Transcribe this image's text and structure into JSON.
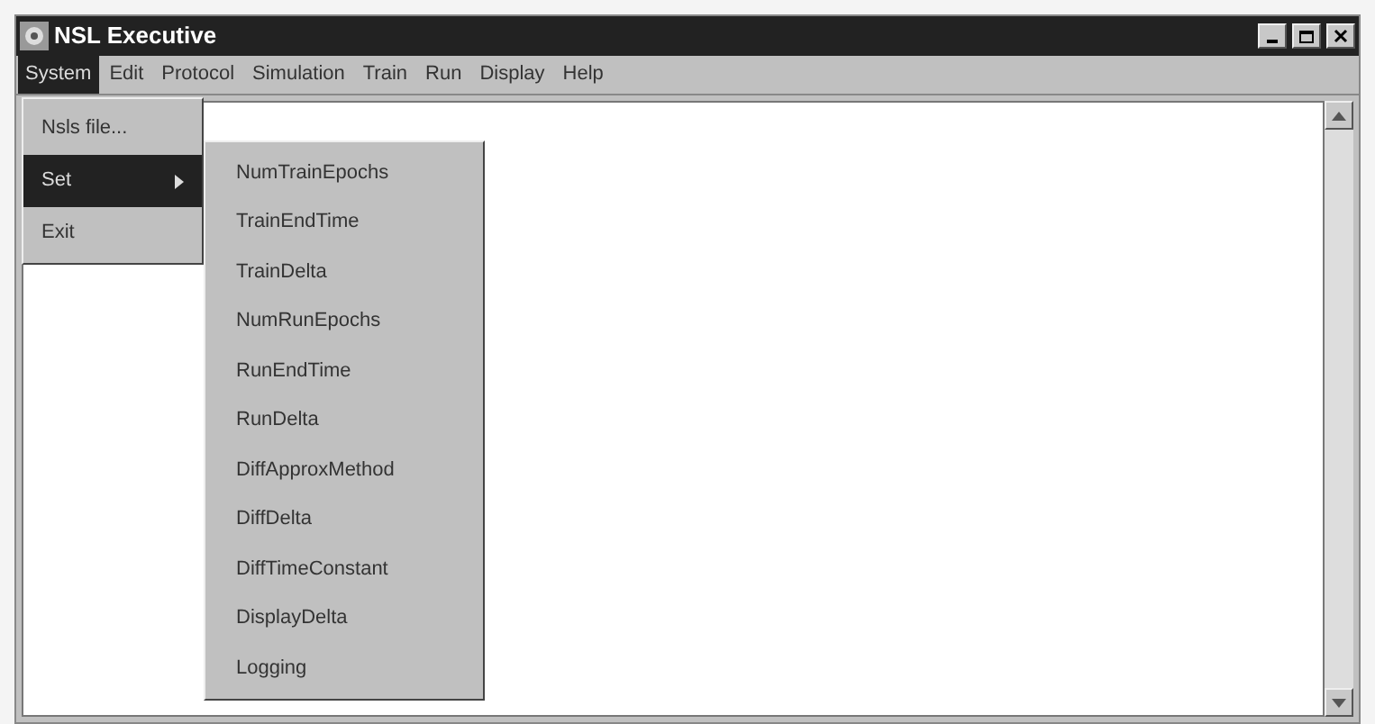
{
  "window": {
    "title": "NSL Executive"
  },
  "menubar": [
    {
      "label": "System",
      "selected": true
    },
    {
      "label": "Edit",
      "selected": false
    },
    {
      "label": "Protocol",
      "selected": false
    },
    {
      "label": "Simulation",
      "selected": false
    },
    {
      "label": "Train",
      "selected": false
    },
    {
      "label": "Run",
      "selected": false
    },
    {
      "label": "Display",
      "selected": false
    },
    {
      "label": "Help",
      "selected": false
    }
  ],
  "system_menu": [
    {
      "label": "Nsls file...",
      "selected": false,
      "kind": "item"
    },
    {
      "label": "Set",
      "selected": true,
      "kind": "submenu"
    },
    {
      "label": "Exit",
      "selected": false,
      "kind": "item"
    }
  ],
  "set_submenu": [
    "NumTrainEpochs",
    "TrainEndTime",
    "TrainDelta",
    "NumRunEpochs",
    "RunEndTime",
    "RunDelta",
    "DiffApproxMethod",
    "DiffDelta",
    "DiffTimeConstant",
    "DisplayDelta",
    "Logging"
  ]
}
